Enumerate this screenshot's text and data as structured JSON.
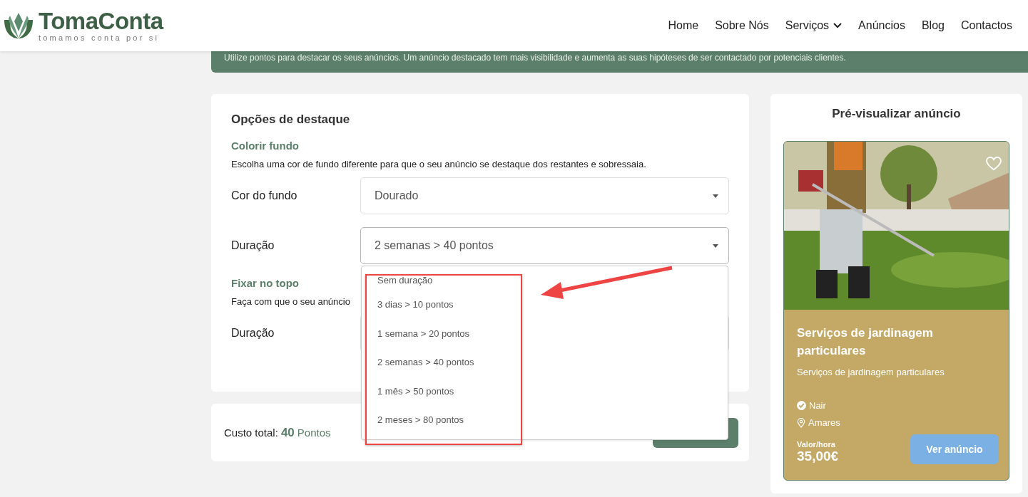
{
  "header": {
    "logo": {
      "name": "TomaConta",
      "tagline": "tomamos conta por si"
    },
    "nav": [
      {
        "label": "Home",
        "kind": "link"
      },
      {
        "label": "Sobre Nós",
        "kind": "link"
      },
      {
        "label": "Serviços",
        "kind": "menu"
      },
      {
        "label": "Anúncios",
        "kind": "link"
      },
      {
        "label": "Blog",
        "kind": "link"
      },
      {
        "label": "Contactos",
        "kind": "link"
      }
    ]
  },
  "banner": {
    "text": "Utilize pontos para destacar os seus anúncios. Um anúncio destacado tem mais visibilidade e aumenta as suas hipóteses de ser contactado por potenciais clientes."
  },
  "options": {
    "title": "Opções de destaque",
    "sections": [
      {
        "heading": "Colorir fundo",
        "description": "Escolha uma cor de fundo diferente para que o seu anúncio se destaque dos restantes e sobressaia.",
        "fields": [
          {
            "label": "Cor do fundo",
            "value": "Dourado"
          },
          {
            "label": "Duração",
            "value": "2 semanas > 40 pontos",
            "expanded": true,
            "options": [
              "Sem duração",
              "3 dias > 10 pontos",
              "1 semana > 20 pontos",
              "2 semanas > 40 pontos",
              "1 mês > 50 pontos",
              "2 meses > 80 pontos"
            ]
          }
        ]
      },
      {
        "heading": "Fixar no topo",
        "description": "Faça com que o seu anúncio",
        "fields": [
          {
            "label": "Duração"
          }
        ]
      }
    ]
  },
  "total": {
    "label": "Custo total:",
    "amount": "40",
    "unit": "Pontos"
  },
  "preview": {
    "title": "Pré-visualizar anúncio",
    "card": {
      "title": "Serviços de jardinagem particulares",
      "subtitle": "Serviços de jardinagem particulares",
      "author": "Nair",
      "location": "Amares",
      "price_label": "Valor/hora",
      "price": "35,00€",
      "button": "Ver anúncio",
      "favorite": false
    }
  }
}
